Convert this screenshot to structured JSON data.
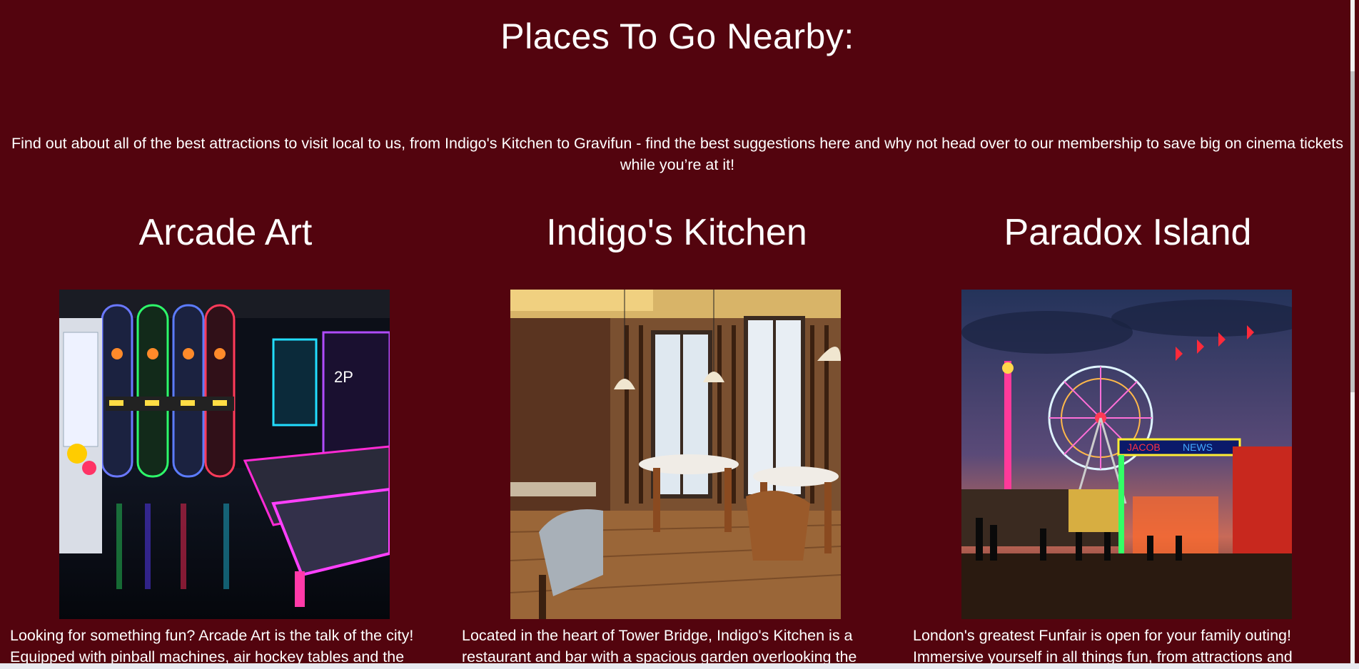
{
  "page": {
    "title": "Places To Go Nearby:",
    "intro": "Find out about all of the best attractions to visit local to us, from Indigo's Kitchen to Gravifun - find the best suggestions here and why not head over to our membership to save big on cinema tickets while you’re at it!"
  },
  "colors": {
    "background": "#53040e",
    "text": "#ffffff"
  },
  "cards": [
    {
      "title": "Arcade Art",
      "image": "arcade-photo",
      "text": "Looking for something fun? Arcade Art is the talk of the city! Equipped with pinball machines, air hockey tables and the"
    },
    {
      "title": "Indigo's Kitchen",
      "image": "restaurant-photo",
      "text": "Located in the heart of Tower Bridge, Indigo's Kitchen is a restaurant and bar with a spacious garden overlooking the"
    },
    {
      "title": "Paradox Island",
      "image": "funfair-photo",
      "text": "London's greatest Funfair is open for your family outing! Immersive yourself in all things fun, from attractions and"
    }
  ]
}
